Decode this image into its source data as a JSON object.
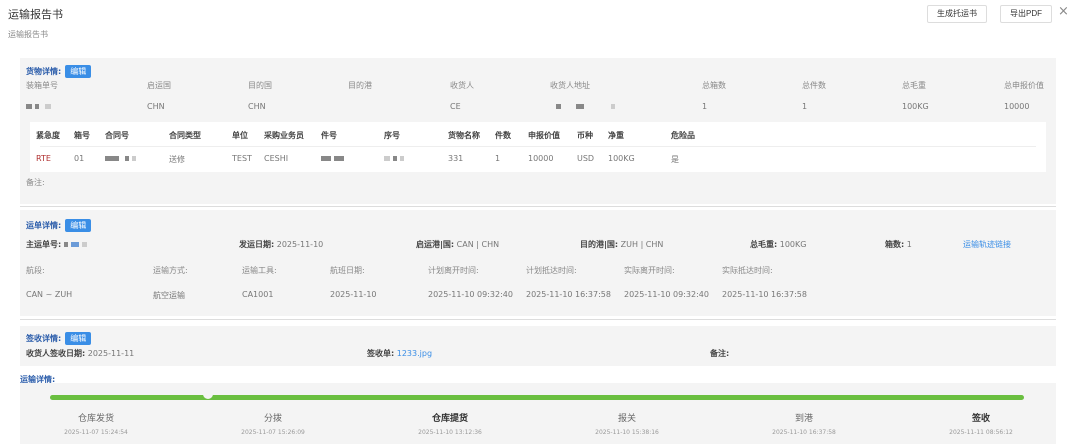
{
  "header": {
    "title": "运输报告书",
    "subtitle": "运输报告书",
    "btn_consign": "生成托运书",
    "btn_pdf": "导出PDF",
    "close": "×"
  },
  "cargo": {
    "section": "货物详情:",
    "edit": "编辑",
    "labels": [
      "装箱单号",
      "启运国",
      "目的国",
      "目的港",
      "收货人",
      "收货人地址",
      "总箱数",
      "总件数",
      "总毛重",
      "总申报价值"
    ],
    "values": [
      "",
      "CHN",
      "CHN",
      "",
      "CE",
      "",
      "1",
      "1",
      "100KG",
      "10000"
    ],
    "table_headers": [
      "紧急度",
      "箱号",
      "合同号",
      "合同类型",
      "单位",
      "采购业务员",
      "件号",
      "序号",
      "货物名称",
      "件数",
      "申报价值",
      "币种",
      "净重",
      "危险品"
    ],
    "table_row": [
      "RTE",
      "01",
      "",
      "送修",
      "TEST",
      "CESHI",
      "",
      "",
      "331",
      "1",
      "10000",
      "USD",
      "100KG",
      "是"
    ],
    "remark": "备注:"
  },
  "waybill": {
    "section": "运单详情:",
    "edit": "编辑",
    "main_no_label": "主运单号:",
    "ship_date_label": "发运日期:",
    "ship_date": "2025-11-10",
    "origin_label": "启运港|国:",
    "origin": "CAN | CHN",
    "dest_label": "目的港|国:",
    "dest": "ZUH | CHN",
    "gross_label": "总毛重:",
    "gross": "100KG",
    "boxes_label": "箱数:",
    "boxes": "1",
    "track_link": "运输轨迹链接",
    "labels": [
      "航段:",
      "运输方式:",
      "运输工具:",
      "航班日期:",
      "计划离开时间:",
      "计划抵达时间:",
      "实际离开时间:",
      "实际抵达时间:"
    ],
    "values": [
      "CAN ~ ZUH",
      "航空运输",
      "CA1001",
      "2025-11-10",
      "2025-11-10 09:32:40",
      "2025-11-10 16:37:58",
      "2025-11-10 09:32:40",
      "2025-11-10 16:37:58"
    ]
  },
  "receipt": {
    "section": "签收详情:",
    "edit": "编辑",
    "date_label": "收货人签收日期:",
    "date": "2025-11-11",
    "doc_label": "签收单:",
    "doc": "1233.jpg",
    "remark": "备注:"
  },
  "transport": {
    "section": "运输详情:",
    "progress": 1.0,
    "color": "#6abf40",
    "steps": [
      {
        "name": "仓库发货",
        "date": "2025-11-07 15:24:54"
      },
      {
        "name": "分拨",
        "date": "2025-11-07 15:26:09"
      },
      {
        "name": "仓库提货",
        "date": "2025-11-10 13:12:36"
      },
      {
        "name": "报关",
        "date": "2025-11-10 15:38:16"
      },
      {
        "name": "到港",
        "date": "2025-11-10 16:37:58"
      },
      {
        "name": "签收",
        "date": "2025-11-11 08:56:12"
      }
    ]
  }
}
